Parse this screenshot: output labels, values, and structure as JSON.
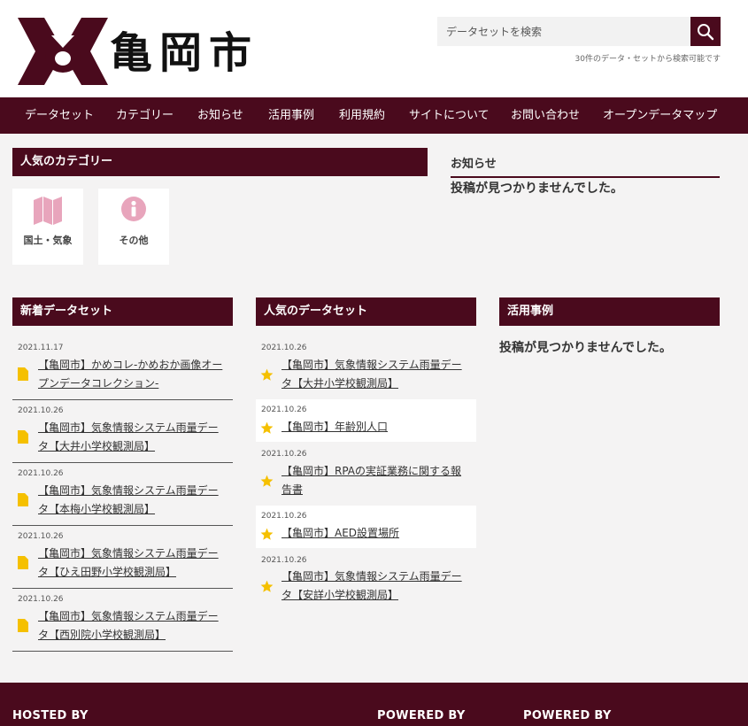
{
  "site": {
    "city_name": "亀岡市"
  },
  "search": {
    "placeholder": "データセットを検索",
    "note": "30件のデータ・セットから検索可能です"
  },
  "nav": {
    "items": [
      {
        "label": "データセット"
      },
      {
        "label": "カテゴリー"
      },
      {
        "label": "お知らせ"
      },
      {
        "label": "活用事例"
      },
      {
        "label": "利用規約"
      },
      {
        "label": "サイトについて"
      },
      {
        "label": "お問い合わせ"
      },
      {
        "label": "オープンデータマップ"
      }
    ]
  },
  "popular_categories": {
    "heading": "人気のカテゴリー",
    "items": [
      {
        "label": "国土・気象",
        "icon": "map-icon"
      },
      {
        "label": "その他",
        "icon": "info-icon"
      }
    ]
  },
  "notices": {
    "heading": "お知らせ",
    "empty": "投稿が見つかりませんでした。"
  },
  "new_datasets": {
    "heading": "新着データセット",
    "items": [
      {
        "date": "2021.11.17",
        "title": "【亀岡市】かめコレ-かめおか画像オープンデータコレクション-"
      },
      {
        "date": "2021.10.26",
        "title": "【亀岡市】気象情報システム雨量データ【大井小学校観測局】"
      },
      {
        "date": "2021.10.26",
        "title": "【亀岡市】気象情報システム雨量データ【本梅小学校観測局】"
      },
      {
        "date": "2021.10.26",
        "title": "【亀岡市】気象情報システム雨量データ【ひえ田野小学校観測局】"
      },
      {
        "date": "2021.10.26",
        "title": "【亀岡市】気象情報システム雨量データ【西別院小学校観測局】"
      }
    ]
  },
  "popular_datasets": {
    "heading": "人気のデータセット",
    "items": [
      {
        "date": "2021.10.26",
        "title": "【亀岡市】気象情報システム雨量データ【大井小学校観測局】"
      },
      {
        "date": "2021.10.26",
        "title": "【亀岡市】年齢別人口"
      },
      {
        "date": "2021.10.26",
        "title": "【亀岡市】RPAの実証業務に関する報告書"
      },
      {
        "date": "2021.10.26",
        "title": "【亀岡市】AED設置場所"
      },
      {
        "date": "2021.10.26",
        "title": "【亀岡市】気象情報システム雨量データ【安詳小学校観測局】"
      }
    ]
  },
  "use_cases": {
    "heading": "活用事例",
    "empty": "投稿が見つかりませんでした。"
  },
  "footer": {
    "hosted_by": "HOSTED BY",
    "powered_by_1": "POWERED BY",
    "powered_by_2": "POWERED BY"
  },
  "colors": {
    "brand": "#4a0a1d",
    "category_icon": "#e8a5bc",
    "star": "#f5c000",
    "doc": "#f5c000"
  }
}
